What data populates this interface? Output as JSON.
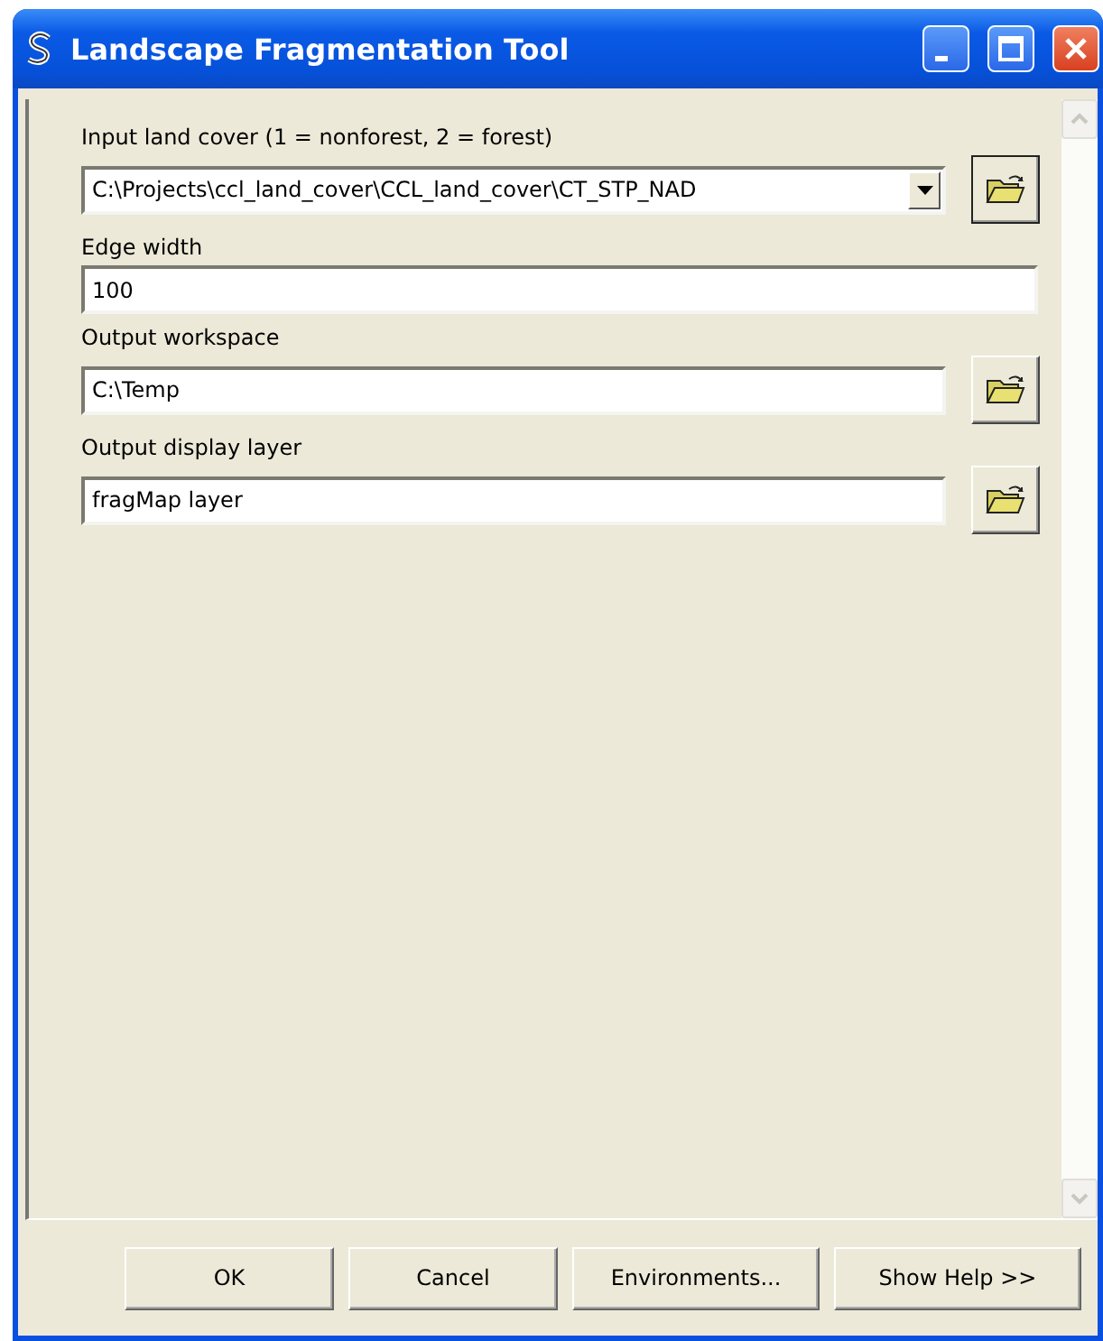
{
  "window": {
    "title": "Landscape Fragmentation Tool"
  },
  "parameters": [
    {
      "label": "Input land cover (1 = nonforest, 2 = forest)",
      "value": "C:\\Projects\\ccl_land_cover\\CCL_land_cover\\CT_STP_NAD",
      "kind": "dropdown",
      "browse": true
    },
    {
      "label": "Edge width",
      "value": "100",
      "kind": "text",
      "browse": false
    },
    {
      "label": "Output workspace",
      "value": "C:\\Temp",
      "kind": "text",
      "browse": true
    },
    {
      "label": "Output display layer",
      "value": "fragMap layer",
      "kind": "text",
      "browse": true
    }
  ],
  "buttons": [
    "OK",
    "Cancel",
    "Environments...",
    "Show Help >>"
  ]
}
